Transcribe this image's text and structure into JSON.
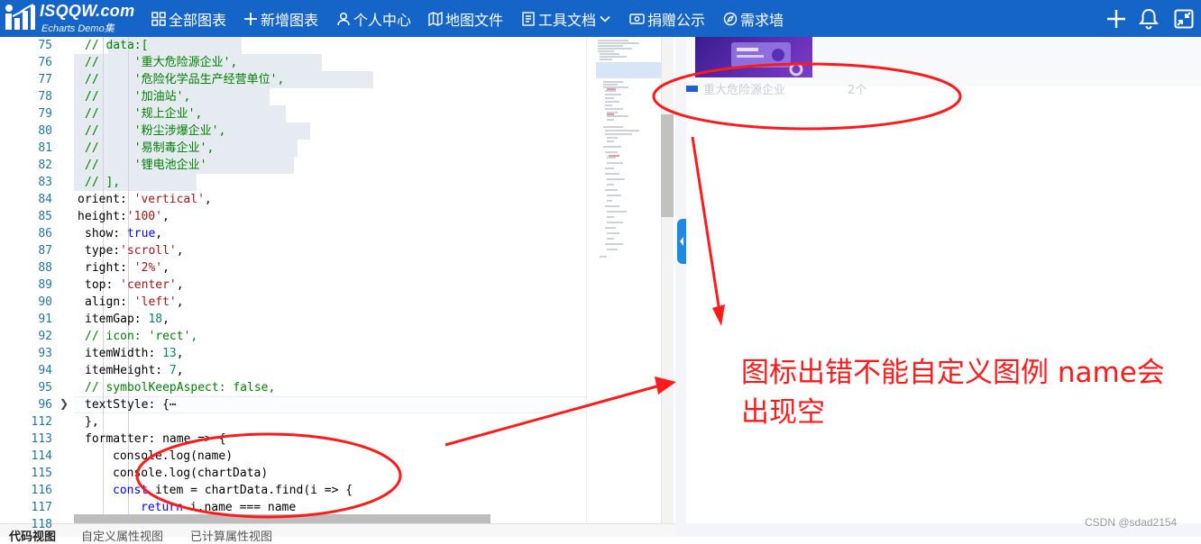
{
  "nav": {
    "logo_title": "ISQQW.com",
    "logo_subtitle": "Echarts Demo集",
    "items": [
      {
        "label": "全部图表",
        "icon": "grid-icon"
      },
      {
        "label": "新增图表",
        "icon": "plus-icon"
      },
      {
        "label": "个人中心",
        "icon": "user-icon"
      },
      {
        "label": "地图文件",
        "icon": "map-icon"
      },
      {
        "label": "工具文档",
        "icon": "document-icon"
      },
      {
        "label": "捐赠公示",
        "icon": "donate-icon"
      },
      {
        "label": "需求墙",
        "icon": "compass-icon"
      }
    ],
    "accent": "#1565c8"
  },
  "editor": {
    "lines": [
      {
        "num": "75",
        "text": "// data:["
      },
      {
        "num": "76",
        "text": "//     '重大危险源企业',"
      },
      {
        "num": "77",
        "text": "//     '危险化学品生产经营单位',"
      },
      {
        "num": "78",
        "text": "//     '加油站',"
      },
      {
        "num": "79",
        "text": "//     '规上企业',"
      },
      {
        "num": "80",
        "text": "//     '粉尘涉爆企业',"
      },
      {
        "num": "81",
        "text": "//     '易制毒企业',"
      },
      {
        "num": "82",
        "text": "//     '锂电池企业'"
      },
      {
        "num": "83",
        "text": "// ],"
      },
      {
        "num": "84",
        "text": "orient: 'vertical',"
      },
      {
        "num": "85",
        "text": "height:'100',"
      },
      {
        "num": "86",
        "text": "show: true,"
      },
      {
        "num": "87",
        "text": "type:'scroll',"
      },
      {
        "num": "88",
        "text": "right: '2%',"
      },
      {
        "num": "89",
        "text": "top: 'center',"
      },
      {
        "num": "90",
        "text": "align: 'left',"
      },
      {
        "num": "91",
        "text": "itemGap: 18,"
      },
      {
        "num": "92",
        "text": "// icon: 'rect',"
      },
      {
        "num": "93",
        "text": "itemWidth: 13,"
      },
      {
        "num": "94",
        "text": "itemHeight: 7,"
      },
      {
        "num": "95",
        "text": "// symbolKeepAspect: false,"
      },
      {
        "num": "96",
        "text": "textStyle: {⋯"
      },
      {
        "num": "112",
        "text": "},"
      },
      {
        "num": "113",
        "text": "formatter: name => {"
      },
      {
        "num": "114",
        "text": "console.log(name)"
      },
      {
        "num": "115",
        "text": "console.log(chartData)"
      },
      {
        "num": "116",
        "text": "const item = chartData.find(i => {"
      },
      {
        "num": "117",
        "text": "return i.name === name"
      },
      {
        "num": "118",
        "text": "})"
      }
    ]
  },
  "preview": {
    "legend_label": "重大危险源企业",
    "legend_count": "2个"
  },
  "annotation": {
    "text": "图标出错不能自定义图例 name会出现空",
    "color": "#ff1a1a"
  },
  "watermark": "CSDN @sdad2154",
  "tabs": [
    {
      "label": "代码视图",
      "active": true
    },
    {
      "label": "自定义属性视图",
      "active": false
    },
    {
      "label": "已计算属性视图",
      "active": false
    }
  ]
}
